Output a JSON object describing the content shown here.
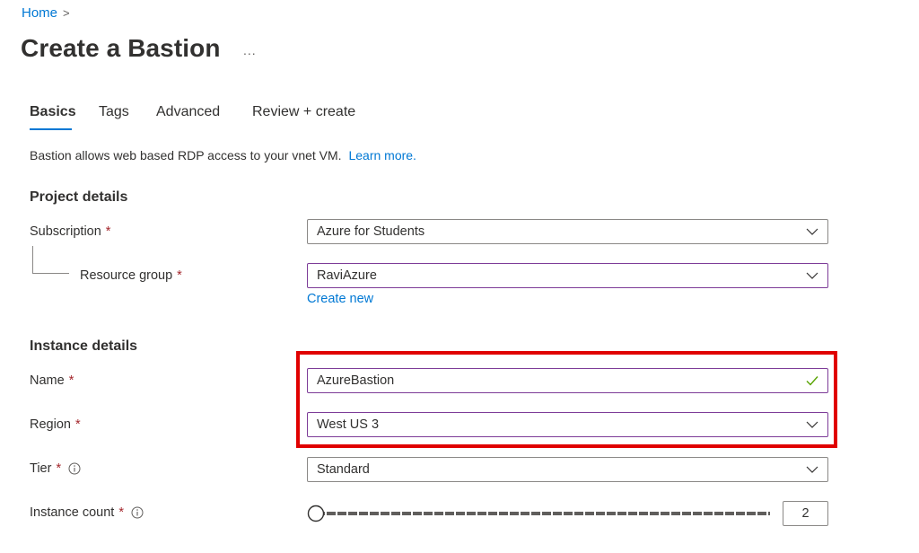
{
  "breadcrumb": {
    "home": "Home",
    "separator": ">"
  },
  "page": {
    "title": "Create a Bastion",
    "more": "..."
  },
  "tabs": [
    {
      "label": "Basics",
      "active": true
    },
    {
      "label": "Tags",
      "active": false
    },
    {
      "label": "Advanced",
      "active": false
    },
    {
      "label": "Review + create",
      "active": false
    }
  ],
  "description": {
    "text": "Bastion allows web based RDP access to your vnet VM.",
    "link": "Learn more."
  },
  "project_details": {
    "title": "Project details",
    "subscription": {
      "label": "Subscription",
      "required": "*",
      "value": "Azure for Students"
    },
    "resource_group": {
      "label": "Resource group",
      "required": "*",
      "value": "RaviAzure",
      "create_new": "Create new"
    }
  },
  "instance_details": {
    "title": "Instance details",
    "name": {
      "label": "Name",
      "required": "*",
      "value": "AzureBastion"
    },
    "region": {
      "label": "Region",
      "required": "*",
      "value": "West US 3"
    },
    "tier": {
      "label": "Tier",
      "required": "*",
      "value": "Standard"
    },
    "instance_count": {
      "label": "Instance count",
      "required": "*",
      "value": "2",
      "slider_fraction": 0.0
    }
  },
  "colors": {
    "accent": "#0078d4",
    "required": "#a4262c",
    "highlight": "#e00000",
    "valid": "#57a300",
    "focus_border": "#7d3c98"
  },
  "icons": {
    "chevron": "chevron-down-icon",
    "check": "checkmark-icon",
    "info": "info-icon",
    "breadcrumb_sep": "chevron-right-icon"
  }
}
